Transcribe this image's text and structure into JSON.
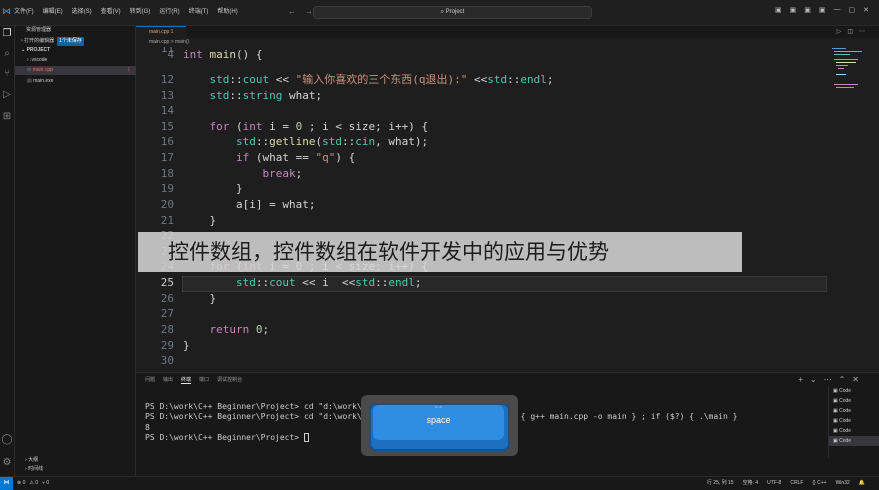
{
  "titlebar": {
    "menus": [
      "文件(F)",
      "编辑(E)",
      "选择(S)",
      "查看(V)",
      "转到(G)",
      "运行(R)",
      "终端(T)",
      "帮助(H)"
    ],
    "search": "Project",
    "nav_back": "←",
    "nav_forward": "→",
    "window_controls": [
      "▣",
      "▣",
      "▣",
      "▣",
      "—",
      "▢",
      "✕"
    ]
  },
  "sidebar": {
    "header": "资源管理器",
    "open_editors": "打开的编辑器",
    "open_editors_badge": "1个未保存",
    "project": "PROJECT",
    "items": [
      {
        "label": ".vscode",
        "type": "folder"
      },
      {
        "label": "main.cpp",
        "errors": "1",
        "selected": true
      },
      {
        "label": "main.exe"
      }
    ],
    "bottom": [
      "大纲",
      "时间线"
    ]
  },
  "tab": {
    "label": "main.cpp 1"
  },
  "breadcrumb": "main.cpp > main()",
  "editor": {
    "lines": [
      {
        "n": "11",
        "t": ""
      },
      {
        "n": "4",
        "t": "int main() {"
      },
      {
        "n": "12",
        "t": "    std::cout << \"输入你喜欢的三个东西(q退出):\" <<std::endl;"
      },
      {
        "n": "13",
        "t": "    std::string what;"
      },
      {
        "n": "14",
        "t": ""
      },
      {
        "n": "15",
        "t": "    for (int i = 0 ; i < size; i++) {"
      },
      {
        "n": "16",
        "t": "        std::getline(std::cin, what);"
      },
      {
        "n": "17",
        "t": "        if (what == \"q\") {"
      },
      {
        "n": "18",
        "t": "            break;"
      },
      {
        "n": "19",
        "t": "        }"
      },
      {
        "n": "20",
        "t": "        a[i] = what;"
      },
      {
        "n": "21",
        "t": "    }"
      },
      {
        "n": "22",
        "t": ""
      },
      {
        "n": "23",
        "t": ""
      },
      {
        "n": "24",
        "t": "    for (int i = 0 ; i < size; i++) {"
      },
      {
        "n": "25",
        "t": "        std::cout << i  <<std::endl;"
      },
      {
        "n": "26",
        "t": "    }"
      },
      {
        "n": "27",
        "t": ""
      },
      {
        "n": "28",
        "t": "    return 0;"
      },
      {
        "n": "29",
        "t": "}"
      },
      {
        "n": "30",
        "t": ""
      }
    ]
  },
  "overlay_caption": "控件数组，控件数组在软件开发中的应用与优势",
  "panel": {
    "tabs": [
      "问题",
      "输出",
      "终端",
      "端口",
      "调试控制台"
    ],
    "active_tab": "终端",
    "terminal_lines": [
      "PS D:\\work\\C++ Beginner\\Project> cd \"d:\\work\\C++ Beginner\\Project\"",
      "PS D:\\work\\C++ Beginner\\Project> cd \"d:\\work\\C++ Beginner\\Project\\\" ; if ($?) { g++ main.cpp -o main } ; if ($?) { .\\main }",
      "8",
      "PS D:\\work\\C++ Beginner\\Project> "
    ],
    "terminal_list": [
      "Code",
      "Code",
      "Code",
      "Code",
      "Code",
      "Code"
    ]
  },
  "key_overlay": {
    "top": "⌃⌃",
    "label": "space"
  },
  "statusbar": {
    "left": [
      "⊗ 0",
      "⚠ 0",
      "⑂ 0"
    ],
    "right": [
      "行 25, 列 15",
      "空格: 4",
      "UTF-8",
      "CRLF",
      "{} C++",
      "Win32",
      "🔔"
    ]
  }
}
